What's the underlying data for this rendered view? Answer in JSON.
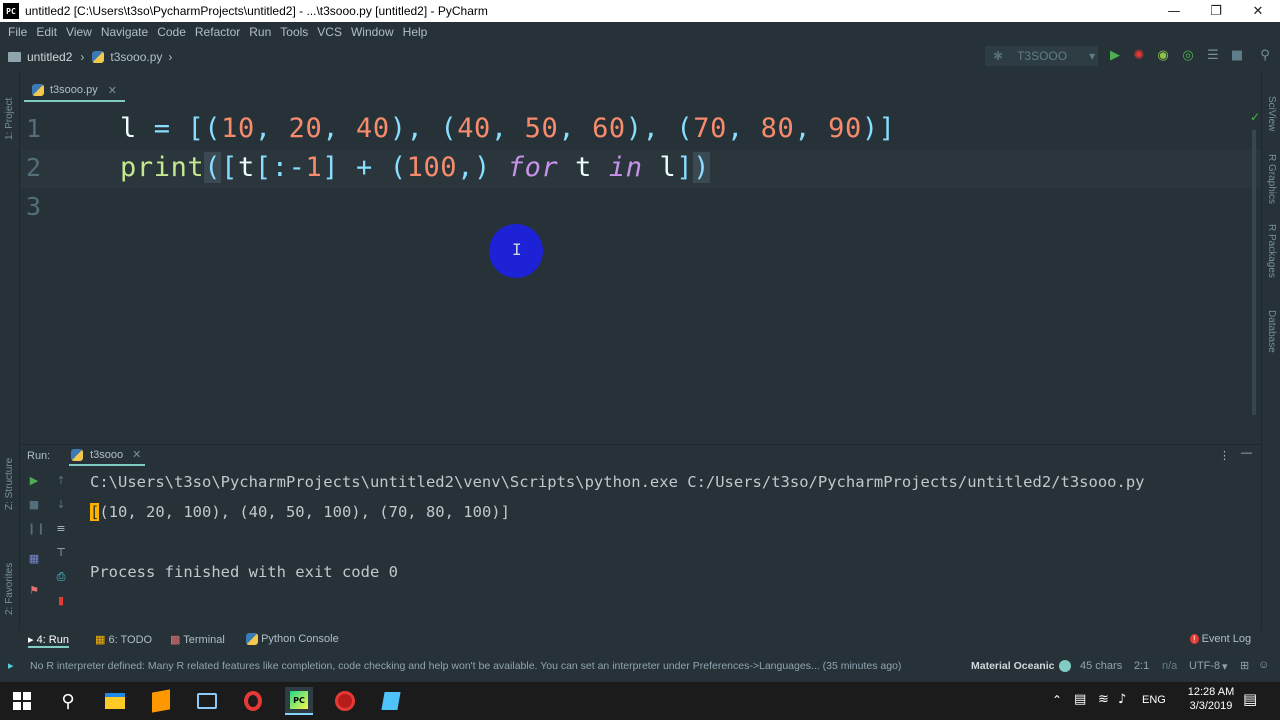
{
  "window": {
    "title": "untitled2 [C:\\Users\\t3so\\PycharmProjects\\untitled2] - ...\\t3sooo.py [untitled2] - PyCharm",
    "app_badge": "PC"
  },
  "menu": [
    "File",
    "Edit",
    "View",
    "Navigate",
    "Code",
    "Refactor",
    "Run",
    "Tools",
    "VCS",
    "Window",
    "Help"
  ],
  "nav": {
    "project": "untitled2",
    "file": "t3sooo.py",
    "run_config": "T3SOOO"
  },
  "left_strip": {
    "project": "1: Project",
    "structure": "Z: Structure",
    "favorites": "2: Favorites"
  },
  "right_strip": {
    "sciview": "SciView",
    "rgraphics": "R Graphics",
    "rpackages": "R Packages",
    "database": "Database"
  },
  "editor": {
    "tab": "t3sooo.py",
    "line_numbers": [
      "1",
      "2",
      "3"
    ]
  },
  "run_panel": {
    "label": "Run:",
    "tab": "t3sooo",
    "lines": [
      "C:\\Users\\t3so\\PycharmProjects\\untitled2\\venv\\Scripts\\python.exe C:/Users/t3so/PycharmProjects/untitled2/t3sooo.py",
      "(10, 20, 100), (40, 50, 100), (70, 80, 100)]",
      "",
      "Process finished with exit code 0"
    ],
    "first_bracket": "["
  },
  "tool_tabs": {
    "run": "4: Run",
    "todo": "6: TODO",
    "terminal": "Terminal",
    "python_console": "Python Console",
    "event_log": "Event Log"
  },
  "status": {
    "message": "No R interpreter defined: Many R related features like completion, code checking and help won't be available. You can set an interpreter under Preferences->Languages... (35 minutes ago)",
    "theme": "Material Oceanic",
    "chars": "45 chars",
    "position": "2:1",
    "na": "n/a",
    "encoding": "UTF-8"
  },
  "taskbar": {
    "time": "12:28 AM",
    "date": "3/3/2019",
    "lang": "ENG"
  },
  "colors": {
    "bg": "#263238",
    "number": "#f78c6c",
    "keyword": "#c792ea",
    "function": "#c3e88d",
    "punctuation": "#89ddff"
  }
}
